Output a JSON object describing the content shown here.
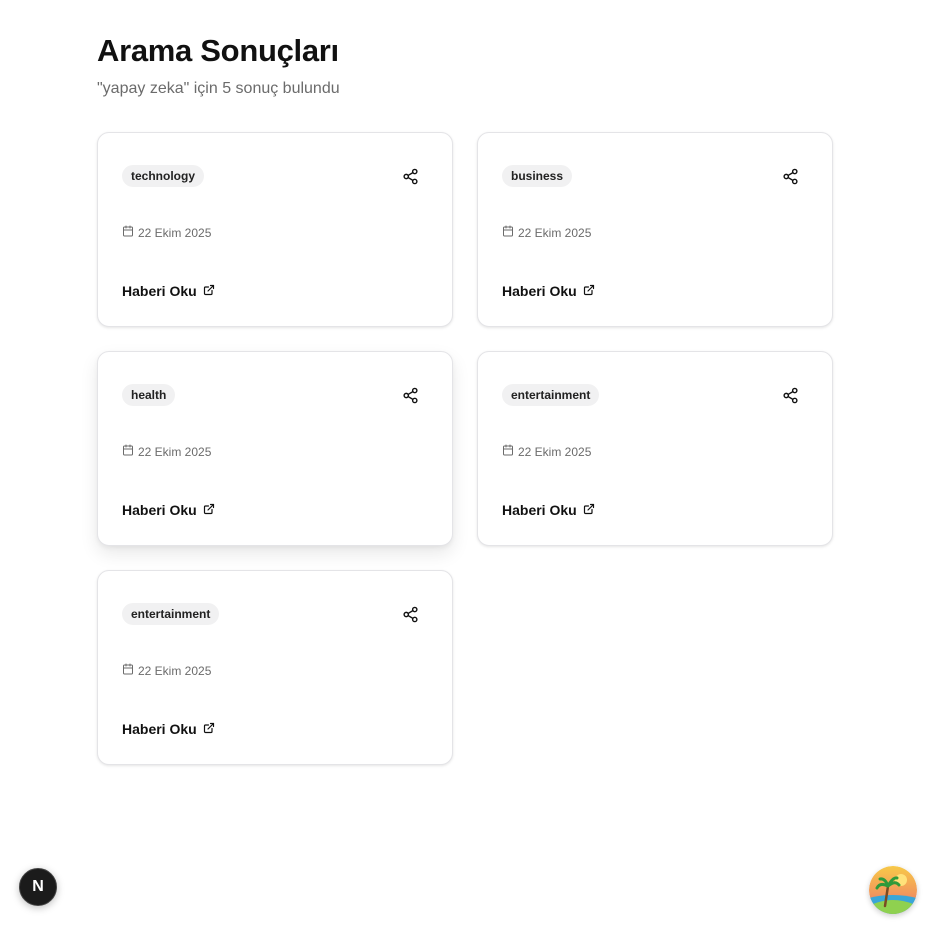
{
  "header": {
    "title": "Arama Sonuçları",
    "subtitle": "\"yapay zeka\" için 5 sonuç bulundu"
  },
  "results": [
    {
      "category": "technology",
      "date": "22 Ekim 2025",
      "read_label": "Haberi Oku"
    },
    {
      "category": "business",
      "date": "22 Ekim 2025",
      "read_label": "Haberi Oku"
    },
    {
      "category": "health",
      "date": "22 Ekim 2025",
      "read_label": "Haberi Oku"
    },
    {
      "category": "entertainment",
      "date": "22 Ekim 2025",
      "read_label": "Haberi Oku"
    },
    {
      "category": "entertainment",
      "date": "22 Ekim 2025",
      "read_label": "Haberi Oku"
    }
  ],
  "dev_badge": {
    "letter": "N",
    "icon": "nextjs-logo-icon"
  },
  "avatar": {
    "icon": "beach-palm-avatar-icon"
  },
  "colors": {
    "text": "#111111",
    "muted": "#6b6b6b",
    "badge_bg": "#f1f1f2",
    "border": "#e4e4e7"
  }
}
